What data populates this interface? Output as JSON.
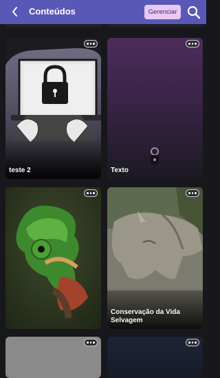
{
  "header": {
    "title": "Conteúdos",
    "manage_label": "Gerenciar",
    "back_icon": "chevron-left-icon",
    "search_icon": "search-icon"
  },
  "colors": {
    "header_bg": "#5a58b6",
    "manage_bg": "#e7c9f4",
    "page_bg": "#17171c"
  },
  "cards": [
    {
      "label": "teste 2",
      "image": "laptop-lock-illustration",
      "more_icon": "more-dots-icon"
    },
    {
      "label": "Texto",
      "image": "purple-gradient-lock",
      "more_icon": "more-dots-icon"
    },
    {
      "label": "",
      "image": "chameleon-photo",
      "more_icon": "more-dots-icon"
    },
    {
      "label": "Conservação da Vida Selvagem",
      "image": "rhinoceros-photo",
      "more_icon": "more-dots-icon"
    },
    {
      "label": "",
      "image": "gray-placeholder",
      "more_icon": "more-dots-icon"
    },
    {
      "label": "",
      "image": "dark-blue-placeholder",
      "more_icon": "more-dots-icon"
    }
  ]
}
